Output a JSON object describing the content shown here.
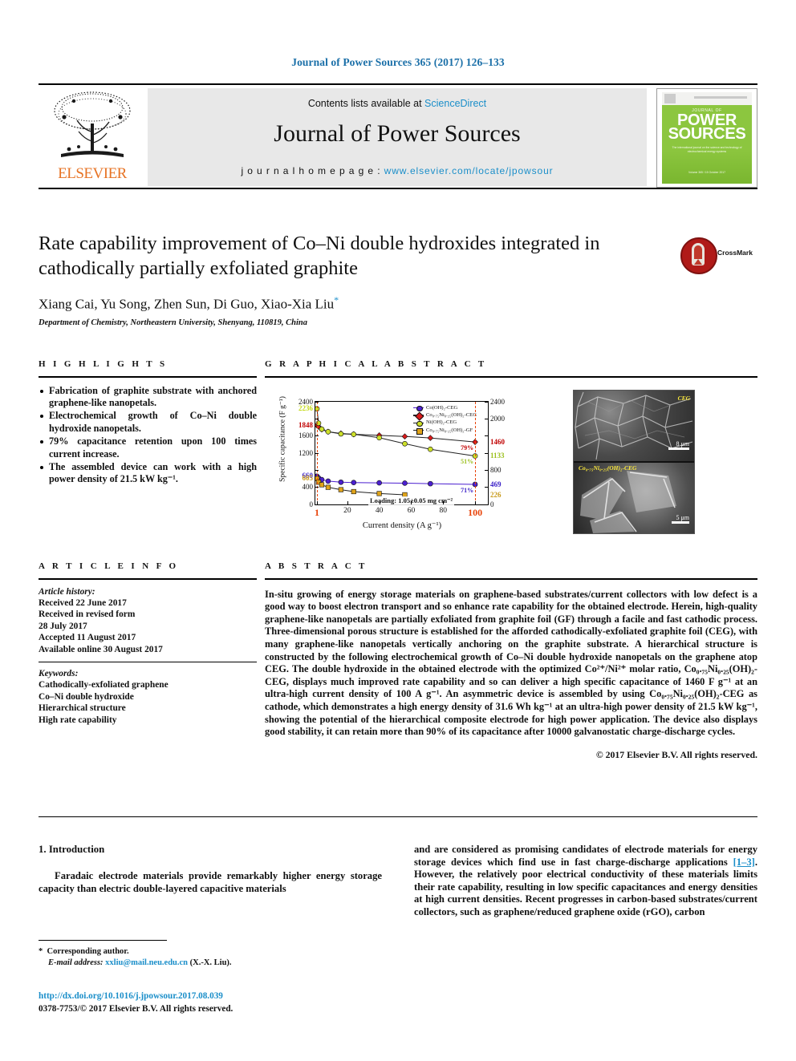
{
  "running_head": "Journal of Power Sources 365 (2017) 126–133",
  "masthead": {
    "contents_prefix": "Contents lists available at ",
    "sciencedirect": "ScienceDirect",
    "journal_name": "Journal of Power Sources",
    "homepage_prefix": "j o u r n a l   h o m e p a g e :  ",
    "homepage_url": "www.elsevier.com/locate/jpowsour",
    "publisher": "ELSEVIER",
    "cover": {
      "journal_small": "JOURNAL OF",
      "line1": "POWER",
      "line2": "SOURCES",
      "subtitle": "The international journal on the science and technology of electrochemical energy systems",
      "bottom": "Volume 365 / 15 October 2017"
    }
  },
  "article": {
    "title": "Rate capability improvement of Co–Ni double hydroxides integrated in cathodically partially exfoliated graphite",
    "authors": "Xiang Cai, Yu Song, Zhen Sun, Di Guo, Xiao-Xia Liu",
    "corresponding_marker": "*",
    "affiliation": "Department of Chemistry, Northeastern University, Shenyang, 110819, China",
    "crossmark_label": "CrossMark"
  },
  "highlights": {
    "heading": "H I G H L I G H T S",
    "items": [
      "Fabrication of graphite substrate with anchored graphene-like nanopetals.",
      "Electrochemical growth of Co–Ni double hydroxide nanopetals.",
      "79% capacitance retention upon 100 times current increase.",
      "The assembled device can work with a high power density of 21.5 kW kg⁻¹."
    ]
  },
  "graphical_abstract": {
    "heading": "G R A P H I C A L   A B S T R A C T"
  },
  "chart_data": {
    "type": "line",
    "title": "",
    "xlabel": "Current density (A g⁻¹)",
    "ylabel": "Specific capacitance (F g⁻¹)",
    "xlim": [
      0,
      108
    ],
    "ylim": [
      0,
      2400
    ],
    "xticks": [
      1,
      20,
      40,
      60,
      80,
      100
    ],
    "yticks_left": [
      0,
      400,
      800,
      1200,
      1600,
      2000,
      2400
    ],
    "ytick_labels_left": [
      "0",
      "400",
      "",
      "1200",
      "1600",
      "",
      "2400"
    ],
    "yticks_right": [
      0,
      400,
      800,
      1200,
      1600,
      2000,
      2400
    ],
    "ytick_labels_right": [
      "0",
      "",
      "800",
      "",
      "",
      "2000",
      "2400"
    ],
    "grid": false,
    "legend_position": "top-right",
    "annotation": "Loading: 1.05±0.05 mg cm⁻²",
    "highlight_lines": [
      1,
      100
    ],
    "left_value_labels": [
      {
        "value": 2236,
        "text": "2236",
        "color": "#c3d916"
      },
      {
        "value": 1848,
        "text": "1848",
        "color": "#c00000"
      },
      {
        "value": 660,
        "text": "660",
        "color": "#3c22c8"
      },
      {
        "value": 605,
        "text": "605",
        "color": "#c89a1a"
      }
    ],
    "right_value_labels": [
      {
        "value": 1460,
        "text": "1460",
        "color": "#c00000"
      },
      {
        "value": 1133,
        "text": "1133",
        "color": "#9bbf1c"
      },
      {
        "value": 469,
        "text": "469",
        "color": "#3c22c8"
      },
      {
        "value": 226,
        "text": "226",
        "color": "#c89a1a"
      }
    ],
    "retention_labels": [
      {
        "text": "79%",
        "color": "#c00000"
      },
      {
        "text": "51%",
        "color": "#9bbf1c"
      },
      {
        "text": "71%",
        "color": "#3c22c8"
      }
    ],
    "series": [
      {
        "name": "Co(OH)₂-CEG",
        "color": "#4b1fd0",
        "marker": "circle",
        "x": [
          1,
          2,
          4,
          8,
          16,
          24,
          40,
          56,
          72,
          100
        ],
        "y": [
          660,
          620,
          580,
          545,
          520,
          512,
          505,
          498,
          485,
          469
        ]
      },
      {
        "name": "Co₀.₇₅Ni₀.₂₅(OH)₂-CEG",
        "color": "#d91a1a",
        "marker": "diamond",
        "x": [
          1,
          2,
          4,
          8,
          16,
          24,
          40,
          56,
          72,
          100
        ],
        "y": [
          1848,
          1820,
          1755,
          1700,
          1660,
          1640,
          1615,
          1590,
          1555,
          1460
        ]
      },
      {
        "name": "Ni(OH)₂-CEG",
        "color": "#cde02a",
        "marker": "circle",
        "x": [
          1,
          2,
          4,
          8,
          16,
          24,
          40,
          56,
          72,
          100
        ],
        "y": [
          2236,
          1900,
          1760,
          1700,
          1650,
          1640,
          1560,
          1420,
          1290,
          1133
        ]
      },
      {
        "name": "Co₀.₇₅Ni₀.₂₅(OH)₂-GF",
        "color": "#e0a41a",
        "marker": "square",
        "x": [
          1,
          2,
          4,
          8,
          16,
          24,
          40,
          56
        ],
        "y": [
          605,
          520,
          460,
          400,
          345,
          300,
          255,
          226
        ]
      }
    ],
    "sem_images": [
      {
        "label": "CEG",
        "scale": "8 μm"
      },
      {
        "label": "Co₀.₇₅Ni₀.₂₅(OH)₂-CEG",
        "scale": "5 μm"
      }
    ]
  },
  "article_info": {
    "heading": "A R T I C L E   I N F O",
    "history_label": "Article history:",
    "history": [
      "Received 22 June 2017",
      "Received in revised form",
      "28 July 2017",
      "Accepted 11 August 2017",
      "Available online 30 August 2017"
    ],
    "keywords_label": "Keywords:",
    "keywords": [
      "Cathodically-exfoliated graphene",
      "Co–Ni double hydroxide",
      "Hierarchical structure",
      "High rate capability"
    ]
  },
  "abstract": {
    "heading": "A B S T R A C T",
    "text": "In-situ growing of energy storage materials on graphene-based substrates/current collectors with low defect is a good way to boost electron transport and so enhance rate capability for the obtained electrode. Herein, high-quality graphene-like nanopetals are partially exfoliated from graphite foil (GF) through a facile and fast cathodic process. Three-dimensional porous structure is established for the afforded cathodically-exfoliated graphite foil (CEG), with many graphene-like nanopetals vertically anchoring on the graphite substrate. A hierarchical structure is constructed by the following electrochemical growth of Co–Ni double hydroxide nanopetals on the graphene atop CEG. The double hydroxide in the obtained electrode with the optimized Co²⁺/Ni²⁺ molar ratio, Co₀.₇₅Ni₀.₂₅(OH)₂-CEG, displays much improved rate capability and so can deliver a high specific capacitance of 1460 F g⁻¹ at an ultra-high current density of 100 A g⁻¹. An asymmetric device is assembled by using Co₀.₇₅Ni₀.₂₅(OH)₂-CEG as cathode, which demonstrates a high energy density of 31.6 Wh kg⁻¹ at an ultra-high power density of 21.5 kW kg⁻¹, showing the potential of the hierarchical composite electrode for high power application. The device also displays good stability, it can retain more than 90% of its capacitance after 10000 galvanostatic charge-discharge cycles.",
    "copyright": "© 2017 Elsevier B.V. All rights reserved."
  },
  "body": {
    "section_number": "1.",
    "section_title": "Introduction",
    "left_paragraph": "Faradaic electrode materials provide remarkably higher energy storage capacity than electric double-layered capacitive materials",
    "right_paragraph_1": "and are considered as promising candidates of electrode materials for energy storage devices which find use in fast charge-discharge applications ",
    "right_reference": "[1–3]",
    "right_paragraph_2": ". However, the relatively poor electrical conductivity of these materials limits their rate capability, resulting in low specific capacitances and energy densities at high current densities. Recent progresses in carbon-based substrates/current collectors, such as graphene/reduced graphene oxide (rGO), carbon"
  },
  "footer": {
    "corresponding_author": "Corresponding author.",
    "email_label": "E-mail address:",
    "email": "xxliu@mail.neu.edu.cn",
    "email_suffix": "(X.-X. Liu).",
    "doi": "http://dx.doi.org/10.1016/j.jpowsour.2017.08.039",
    "issn": "0378-7753/© 2017 Elsevier B.V. All rights reserved."
  }
}
